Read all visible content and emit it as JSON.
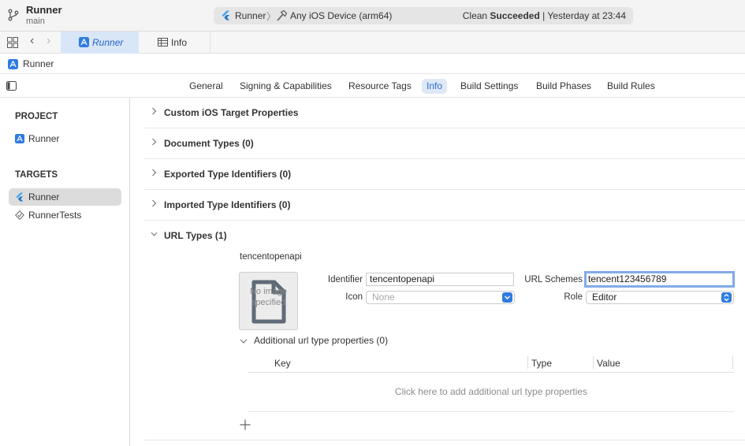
{
  "titlebar": {
    "project": "Runner",
    "branch": "main",
    "scheme": "Runner",
    "separator": "〉",
    "device": "Any iOS Device (arm64)",
    "status_prefix": "Clean ",
    "status_bold": "Succeeded",
    "status_suffix": " | Yesterday at 23:44"
  },
  "tabbar": {
    "tabs": [
      {
        "label": "Runner",
        "active": true
      },
      {
        "label": "Info",
        "active": false
      }
    ]
  },
  "breadcrumb": {
    "label": "Runner"
  },
  "editor_tabs": [
    {
      "label": "General"
    },
    {
      "label": "Signing & Capabilities"
    },
    {
      "label": "Resource Tags"
    },
    {
      "label": "Info",
      "active": true
    },
    {
      "label": "Build Settings"
    },
    {
      "label": "Build Phases"
    },
    {
      "label": "Build Rules"
    }
  ],
  "sidebar": {
    "project_header": "PROJECT",
    "project_items": [
      {
        "label": "Runner",
        "icon": "app-icon"
      }
    ],
    "targets_header": "TARGETS",
    "target_items": [
      {
        "label": "Runner",
        "icon": "flutter-icon",
        "selected": true
      },
      {
        "label": "RunnerTests",
        "icon": "test-target-icon",
        "selected": false
      }
    ]
  },
  "sections": [
    {
      "label": "Custom iOS Target Properties",
      "expanded": false
    },
    {
      "label": "Document Types (0)",
      "expanded": false
    },
    {
      "label": "Exported Type Identifiers (0)",
      "expanded": false
    },
    {
      "label": "Imported Type Identifiers (0)",
      "expanded": false
    },
    {
      "label": "URL Types (1)",
      "expanded": true
    }
  ],
  "url_type": {
    "title": "tencentopenapi",
    "image_placeholder": "No image specified",
    "identifier_label": "Identifier",
    "identifier_value": "tencentopenapi",
    "icon_label": "Icon",
    "icon_value": "None",
    "url_schemes_label": "URL Schemes",
    "url_schemes_value": "tencent123456789",
    "role_label": "Role",
    "role_value": "Editor",
    "additional_label": "Additional url type properties (0)",
    "table_columns": [
      "Key",
      "Type",
      "Value"
    ],
    "table_empty": "Click here to add additional url type properties",
    "add_symbol": "+"
  },
  "colors": {
    "accent": "#2c6fd1",
    "selected_tab_bg": "#d8e6f8",
    "sidebar_selected": "#dcdcdc"
  }
}
